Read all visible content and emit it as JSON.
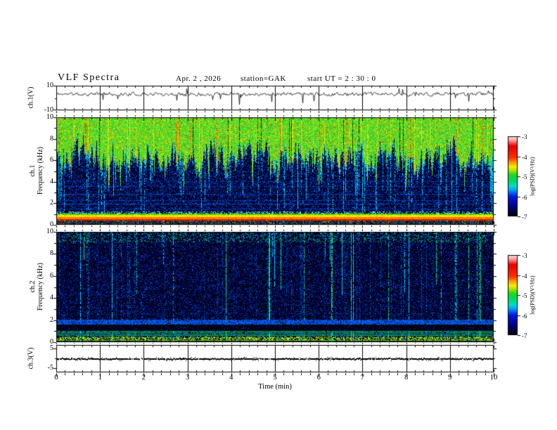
{
  "header": {
    "title": "VLF Spectra",
    "date": "Apr. 2 , 2026",
    "station": "station=GAK",
    "start_ut": "start UT =  2 : 30 : 0"
  },
  "axes": {
    "time": {
      "label": "Time  (min)",
      "min": 0,
      "max": 10,
      "major_tick_labels": [
        "0",
        "1",
        "2",
        "3",
        "4",
        "5",
        "6",
        "7",
        "8",
        "9",
        "10"
      ],
      "minor_divisions": 5
    },
    "freq": {
      "unit": "kHz",
      "min": 0,
      "max": 10,
      "major_tick_labels": [
        "10",
        "8",
        "6",
        "4",
        "2",
        "0"
      ]
    }
  },
  "panels": [
    {
      "id": "ch1-voltage",
      "type": "line",
      "ylabel": "ch.1(V)",
      "y_ticks": [
        "10",
        "-10"
      ],
      "y_range": [
        -10,
        10
      ]
    },
    {
      "id": "ch1-spectrogram",
      "type": "spectrogram",
      "ylabel_ch": "ch.1",
      "ylabel_axis": "Frequency (kHz)",
      "y_ticks": [
        "10",
        "8",
        "6",
        "4",
        "2",
        "0"
      ]
    },
    {
      "id": "ch2-spectrogram",
      "type": "spectrogram",
      "ylabel_ch": "ch.2",
      "ylabel_axis": "Frequency (kHz)",
      "y_ticks": [
        "10",
        "8",
        "6",
        "4",
        "2",
        "0"
      ]
    },
    {
      "id": "ch3-voltage",
      "type": "line",
      "ylabel": "ch.3(V)",
      "y_ticks": [
        "5",
        "-5"
      ],
      "y_range": [
        -6.6,
        6.6
      ]
    }
  ],
  "colorbars": [
    {
      "label": "log(PSD)(V²/Hz)",
      "tick_labels": [
        "-3",
        "-4",
        "-5",
        "-6",
        "-7"
      ],
      "value_range": [
        -7,
        -3
      ]
    },
    {
      "label": "log(PSD)(V²/Hz)",
      "tick_labels": [
        "-3",
        "-4",
        "-5",
        "-6",
        "-7"
      ],
      "value_range": [
        -7,
        -3
      ]
    }
  ],
  "colormap_stops": [
    [
      0,
      "#000000"
    ],
    [
      0.12,
      "#000080"
    ],
    [
      0.25,
      "#0018e0"
    ],
    [
      0.33,
      "#00a0ff"
    ],
    [
      0.38,
      "#00e0c0"
    ],
    [
      0.45,
      "#00d860"
    ],
    [
      0.52,
      "#20d820"
    ],
    [
      0.58,
      "#b0e800"
    ],
    [
      0.62,
      "#ffe800"
    ],
    [
      0.68,
      "#ff9000"
    ],
    [
      0.73,
      "#ff3000"
    ],
    [
      0.88,
      "#e80000"
    ],
    [
      0.94,
      "#ff8888"
    ],
    [
      1,
      "#ffecec"
    ]
  ],
  "chart_data": [
    {
      "panel": "ch.1(V)",
      "type": "line",
      "x_range_min": [
        0,
        10
      ],
      "y_range": [
        -10,
        10
      ],
      "baseline": 3.2,
      "noise_amplitude": 1.4,
      "neg_spike_prob": 0.013,
      "neg_spike_depth": [
        -3,
        -8.5
      ],
      "pos_spike_prob": 0.006,
      "seed": 11
    },
    {
      "panel": "ch.1 spectrogram",
      "type": "heatmap",
      "x_range_min": [
        0,
        10
      ],
      "freq_range_khz": [
        0,
        10
      ],
      "psd_range_log": [
        -7,
        -3
      ],
      "broadband_region": {
        "from_khz_jagged": [
          4,
          8.5
        ],
        "mean_boundary_khz": 6.3,
        "to_khz": 10,
        "level_log_psd": "-4.5 to -3.5 (green/yellow, red streaks)"
      },
      "dark_region_level": "-7 to -6 with blue speckle and cyan vertical streaks",
      "horizontal_lines": [
        {
          "khz": 4.05,
          "alpha": 0.3
        },
        {
          "khz": 3.6,
          "alpha": 0.35
        },
        {
          "khz": 2.9,
          "alpha": 0.5
        },
        {
          "khz": 2.3,
          "alpha": 0.45
        },
        {
          "khz": 1.95,
          "alpha": 0.55
        },
        {
          "khz": 1.5,
          "alpha": 0.4
        }
      ],
      "bottom_bands": [
        {
          "khz": [
            1.0,
            1.12
          ],
          "desc": "green line ~ -4.8"
        },
        {
          "khz": [
            0.78,
            1.0
          ],
          "desc": "yellow band ~ -4.3"
        },
        {
          "khz": [
            0.58,
            0.78
          ],
          "desc": "orange band ~ -3.9"
        },
        {
          "khz": [
            0.45,
            0.58
          ],
          "desc": "red band ~ -3.5"
        },
        {
          "khz": [
            0.0,
            0.45
          ],
          "desc": "dark mixed speckle"
        }
      ],
      "seed": 21
    },
    {
      "panel": "ch.2 spectrogram",
      "type": "heatmap",
      "x_range_min": [
        0,
        10
      ],
      "freq_range_khz": [
        0,
        10
      ],
      "psd_range_log": [
        -7,
        -3
      ],
      "background_level": "-7 to -6.2 (black/dark blue with cyan-green vertical streaks)",
      "blue_band_khz": [
        1.6,
        2.1
      ],
      "dark_band_khz": [
        1.05,
        1.6
      ],
      "faint_lines": [
        {
          "khz": 6.15,
          "alpha": 0.25
        },
        {
          "khz": 4.3,
          "alpha": 0.22
        },
        {
          "khz": 2.6,
          "alpha": 0.3
        }
      ],
      "bottom_lines_khz": [
        1.02,
        0.89,
        0.76,
        0.64
      ],
      "speckle_band_khz": [
        0.25,
        0.55
      ],
      "green_line_khz": 0.22,
      "red_line_khz": 0.08,
      "seed": 31
    },
    {
      "panel": "ch.3(V)",
      "type": "line",
      "x_range_min": [
        0,
        10
      ],
      "y_range": [
        -6.6,
        6.6
      ],
      "baseline": 0,
      "appearance": "dense flat black noise band at ~0 V",
      "seed": 41
    }
  ]
}
